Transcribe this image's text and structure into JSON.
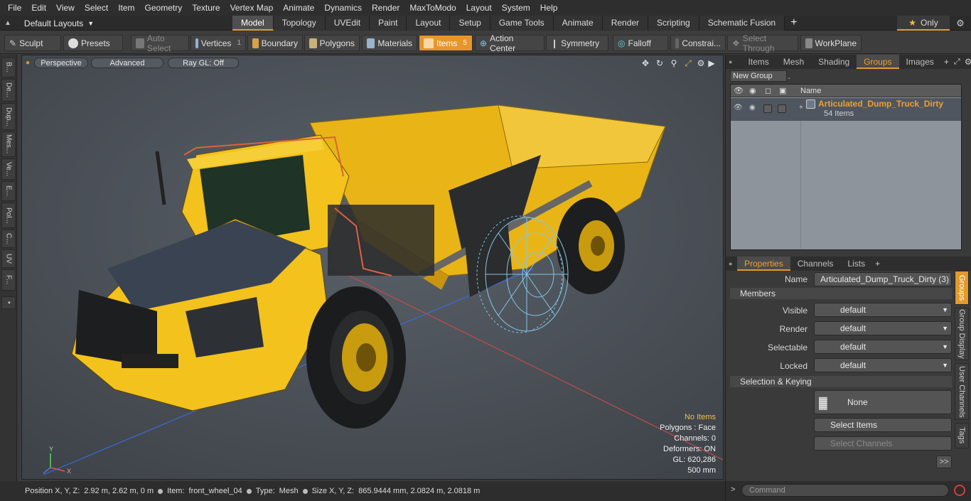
{
  "menu": [
    "File",
    "Edit",
    "View",
    "Select",
    "Item",
    "Geometry",
    "Texture",
    "Vertex Map",
    "Animate",
    "Dynamics",
    "Render",
    "MaxToModo",
    "Layout",
    "System",
    "Help"
  ],
  "layouts": {
    "label": "Default Layouts"
  },
  "context_tabs": [
    "Model",
    "Topology",
    "UVEdit",
    "Paint",
    "Layout",
    "Setup",
    "Game Tools",
    "Animate",
    "Render",
    "Scripting",
    "Schematic Fusion"
  ],
  "active_tab": "Model",
  "only_label": "Only",
  "toolbar": {
    "sculpt": "Sculpt",
    "presets": "Presets",
    "auto_select": "Auto Select",
    "vertices": "Vertices",
    "vertices_count": "1",
    "boundary": "Boundary",
    "polygons": "Polygons",
    "materials": "Materials",
    "items": "Items",
    "items_count": "5",
    "action_center": "Action Center",
    "symmetry": "Symmetry",
    "falloff": "Falloff",
    "constraints": "Constrai...",
    "select_through": "Select Through",
    "workplane": "WorkPlane"
  },
  "left_tabs": [
    "B...",
    "De...",
    "Dup...",
    "Mes...",
    "Ve...",
    "E...",
    "Pol...",
    "C...",
    "UV",
    "F..."
  ],
  "viewport": {
    "perspective": "Perspective",
    "advanced": "Advanced",
    "raygl": "Ray GL: Off",
    "stats": {
      "no_items": "No Items",
      "polygons": "Polygons : Face",
      "channels": "Channels: 0",
      "deformers": "Deformers: ON",
      "gl": "GL: 620,286",
      "scale": "500 mm"
    },
    "axis": {
      "y": "Y",
      "x": "X"
    }
  },
  "status": {
    "position_label": "Position X, Y, Z:",
    "position_value": "2.92 m, 2.62 m, 0 m",
    "item_label": "Item:",
    "item_value": "front_wheel_04",
    "type_label": "Type:",
    "type_value": "Mesh",
    "size_label": "Size X, Y, Z:",
    "size_value": "865.9444 mm, 2.0824 m, 2.0818 m"
  },
  "right_top_tabs": [
    "Items",
    "Mesh ...",
    "Shading",
    "Groups",
    "Images"
  ],
  "active_right_top_tab": "Groups",
  "new_group_label": "New Group",
  "group_list": {
    "name_header": "Name",
    "group_name": "Articulated_Dump_Truck_Dirty",
    "group_count": "54 Items"
  },
  "props_tabs": [
    "Properties",
    "Channels",
    "Lists"
  ],
  "props": {
    "name_label": "Name",
    "name_value": "Articulated_Dump_Truck_Dirty (3)",
    "members_header": "Members",
    "visible_label": "Visible",
    "visible_value": "default",
    "render_label": "Render",
    "render_value": "default",
    "selectable_label": "Selectable",
    "selectable_value": "default",
    "locked_label": "Locked",
    "locked_value": "default",
    "selkey_header": "Selection & Keying",
    "none_label": "None",
    "select_items": "Select Items",
    "select_channels": "Select Channels",
    "more": ">>"
  },
  "right_vtabs": [
    "Groups",
    "Group Display",
    "User Channels",
    "Tags"
  ],
  "command_placeholder": "Command",
  "colors": {
    "accent": "#e29a2a",
    "truck_yellow": "#f3c21c",
    "wire_blue": "#7fc6e8",
    "group_orange": "#f0a030"
  }
}
